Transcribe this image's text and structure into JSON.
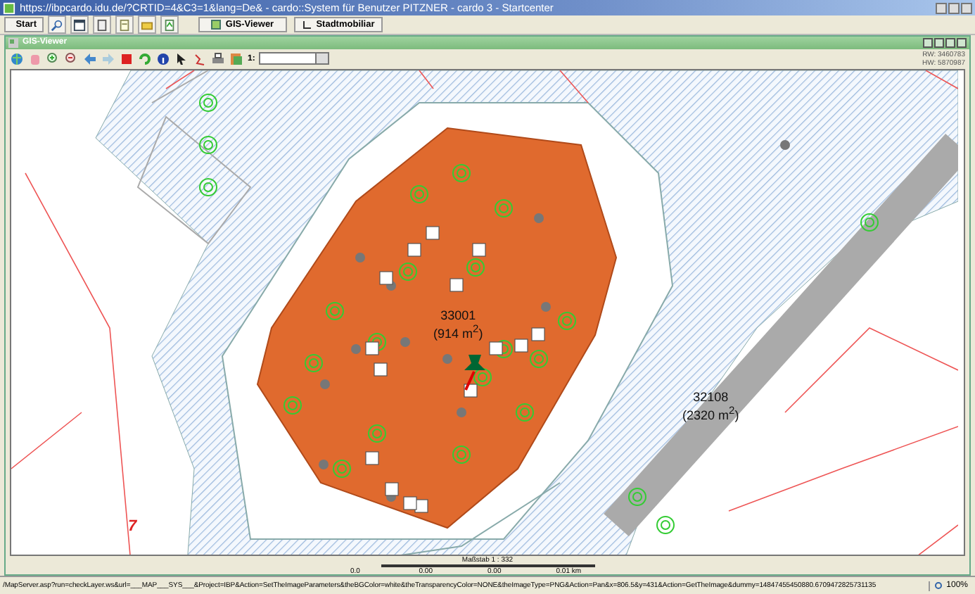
{
  "window": {
    "title": "https://ibpcardo.idu.de/?CRTID=4&C3=1&lang=De& - cardo::System für Benutzer PITZNER - cardo 3 - Startcenter"
  },
  "taskbar": {
    "start": "Start",
    "tabs": [
      {
        "label": "GIS-Viewer",
        "selected": false
      },
      {
        "label": "Stadtmobiliar",
        "selected": false
      }
    ]
  },
  "viewer": {
    "title": "GIS-Viewer",
    "scale_prefix": "1:",
    "coordinates": [
      "RW: 3460783",
      "HW: 5870987"
    ],
    "map_labels": [
      {
        "number": "33001",
        "area": "(914 m$^{2}$)"
      },
      {
        "number": "32108",
        "area": "(2320 m$^{2}$)"
      }
    ],
    "parcel_number": "7",
    "scale": {
      "title": "Maßstab 1 : 332",
      "ticks": [
        "0.0",
        "0.00",
        "0.00",
        "0.01 km"
      ]
    }
  },
  "status_bar": {
    "url": "/MapServer.asp?run=checkLayer.ws&url=___MAP___SYS___&Project=IBP&Action=SetTheImageParameters&theBGColor=white&theTransparencyColor=NONE&theImageType=PNG&Action=Pan&x=806.5&y=431&Action=GetTheImage&dummy=14847455450880.6709472825731135",
    "zoom": "100%"
  }
}
